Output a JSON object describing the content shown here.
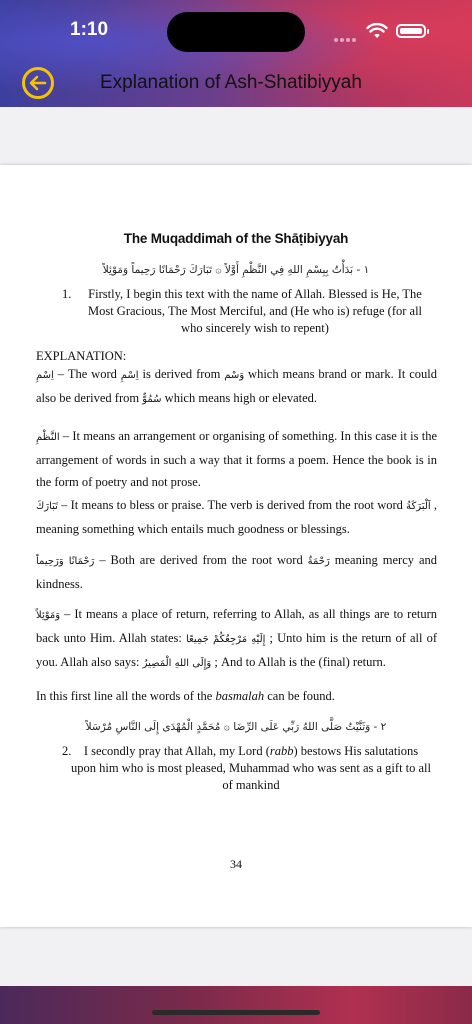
{
  "status_bar": {
    "time": "1:10"
  },
  "header": {
    "title": "Explanation of Ash-Shatibiyyah"
  },
  "colors": {
    "accent": "#f5c400",
    "header_start": "#3c3f9e",
    "header_end": "#c9385a"
  },
  "page": {
    "title": "The Muqaddimah of the Shāṭibiyyah",
    "verse1": {
      "arabic": "١ - بَدَأْتُ بِبِسْمِ اللهِ فِي النَّظْمِ أَوَّلاً ۞ تَبَارَكَ رَحْمَانًا رَحِيماً وَمَوْئِلاً",
      "number": "1.",
      "text": "Firstly, I begin this text with the name of Allah. Blessed is He, The Most Gracious, The Most Merciful, and (He who is) refuge (for all who sincerely wish to repent)"
    },
    "explanation_label": "EXPLANATION:",
    "p1": {
      "ar1": "اِسْمِ",
      "t1": " – The word ",
      "ar2": "اِسْمِ",
      "t2": " is derived from ",
      "ar3": "وَسْم",
      "t3": " which means brand or mark. It could also be derived from ",
      "ar4": "سُمُوٌّ",
      "t4": " which means high or elevated."
    },
    "p2": {
      "ar1": "النَّظْمِ",
      "t1": " – It means an arrangement or organising of something. In this case it is the arrangement of words in such a way that it forms a poem. Hence the book is in the form of poetry and not prose."
    },
    "p3": {
      "ar1": "تَبَارَكَ",
      "t1": " – It means to bless or praise. The verb is derived from the root word ",
      "ar2": "اَلْبَرَكَةُ",
      "t2": " , meaning something which entails much goodness or blessings."
    },
    "p4": {
      "ar1": "رَحْمَانًا وَرَحِيماً",
      "t1": " – Both are derived from the root word ",
      "ar2": "رَحْمَةٌ",
      "t2": " meaning mercy and kindness."
    },
    "p5": {
      "ar1": "وَمَوْئِلاً",
      "t1": " – It means a place of return, referring to Allah, as all things are to return back unto Him. Allah states: ",
      "ar2": "إِلَيْهِ مَرْجِعُكُمْ جَمِيعًا",
      "t2": " ; Unto him is the return of all of you. Allah also says: ",
      "ar3": "وَإِلَى اللهِ الْمَصِيرُ",
      "t3": " ; And to Allah is the (final) return."
    },
    "p6": {
      "t1": "In this first line all the words of the ",
      "em": "basmalah",
      "t2": " can be found."
    },
    "verse2": {
      "arabic": "٢ - وَثَنَّيْتُ صَلَّى اللهُ رَبِّي عَلَى الرِّضَا ۞ مُحَمَّدٍ الْمُهْدَى إِلَى النَّاسِ مُرْسَلاً",
      "number": "2.",
      "t1": "I secondly pray that Allah, my Lord (",
      "em": "rabb",
      "t2": ") bestows His salutations upon him who is most pleased, Muhammad who was sent as a gift to all of mankind"
    },
    "page_number": "34"
  }
}
